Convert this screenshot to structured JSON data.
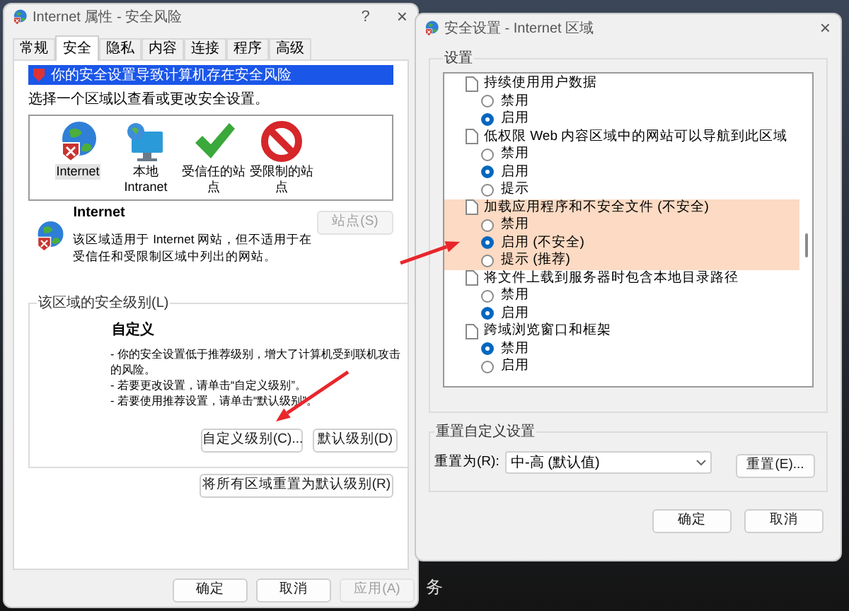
{
  "desktop": {
    "taskbar_text": "务"
  },
  "internet_properties": {
    "title": "Internet 属性 - 安全风险",
    "help": "?",
    "close": "×",
    "tabs": [
      {
        "label": "常规",
        "selected": false
      },
      {
        "label": "安全",
        "selected": true
      },
      {
        "label": "隐私",
        "selected": false
      },
      {
        "label": "内容",
        "selected": false
      },
      {
        "label": "连接",
        "selected": false
      },
      {
        "label": "程序",
        "selected": false
      },
      {
        "label": "高级",
        "selected": false
      }
    ],
    "warning_banner": "你的安全设置导致计算机存在安全风险",
    "zone_prompt": "选择一个区域以查看或更改安全设置。",
    "zones": [
      {
        "label": "Internet",
        "kind": "globe",
        "selected": true
      },
      {
        "label": "本地 Intranet",
        "kind": "network",
        "selected": false
      },
      {
        "label": "受信任的站点",
        "kind": "trusted",
        "selected": false
      },
      {
        "label": "受限制的站点",
        "kind": "restricted",
        "selected": false
      }
    ],
    "zone_title": "Internet",
    "sites_button": {
      "label": "站点(S)",
      "disabled": true
    },
    "zone_description": "该区域适用于 Internet 网站，但不适用于在受信任和受限制区域中列出的网站。",
    "security_level": {
      "label": "该区域的安全级别(L)",
      "level_name": "自定义",
      "bullets": [
        "- 你的安全设置低于推荐级别，增大了计算机受到联机攻击的风险。",
        "- 若要更改设置，请单击“自定义级别”。",
        "- 若要使用推荐设置，请单击“默认级别”。"
      ],
      "custom_button": "自定义级别(C)...",
      "default_button": "默认级别(D)"
    },
    "reset_all_button": "将所有区域重置为默认级别(R)",
    "footer_buttons": [
      {
        "label": "确定",
        "disabled": false
      },
      {
        "label": "取消",
        "disabled": false
      },
      {
        "label": "应用(A)",
        "disabled": true
      }
    ]
  },
  "security_settings": {
    "title": "安全设置 - Internet 区域",
    "close": "×",
    "settings_label": "设置",
    "settings": [
      {
        "label": "持续使用用户数据",
        "highlighted": false,
        "options": [
          {
            "label": "禁用",
            "selected": false
          },
          {
            "label": "启用",
            "selected": true
          }
        ]
      },
      {
        "label": "低权限 Web 内容区域中的网站可以导航到此区域",
        "highlighted": false,
        "options": [
          {
            "label": "禁用",
            "selected": false
          },
          {
            "label": "启用",
            "selected": true
          },
          {
            "label": "提示",
            "selected": false
          }
        ]
      },
      {
        "label": "加载应用程序和不安全文件 (不安全)",
        "highlighted": true,
        "options": [
          {
            "label": "禁用",
            "selected": false
          },
          {
            "label": "启用 (不安全)",
            "selected": true
          },
          {
            "label": "提示 (推荐)",
            "selected": false
          }
        ]
      },
      {
        "label": "将文件上载到服务器时包含本地目录路径",
        "highlighted": false,
        "options": [
          {
            "label": "禁用",
            "selected": false
          },
          {
            "label": "启用",
            "selected": true
          }
        ]
      },
      {
        "label": "跨域浏览窗口和框架",
        "highlighted": false,
        "options": [
          {
            "label": "禁用",
            "selected": true
          },
          {
            "label": "启用",
            "selected": false
          }
        ]
      }
    ],
    "reset_group": {
      "label": "重置自定义设置",
      "reset_to_label": "重置为(R):",
      "dropdown_value": "中-高 (默认值)",
      "reset_button": "重置(E)..."
    },
    "footer_buttons": [
      {
        "label": "确定",
        "disabled": false
      },
      {
        "label": "取消",
        "disabled": false
      }
    ]
  }
}
